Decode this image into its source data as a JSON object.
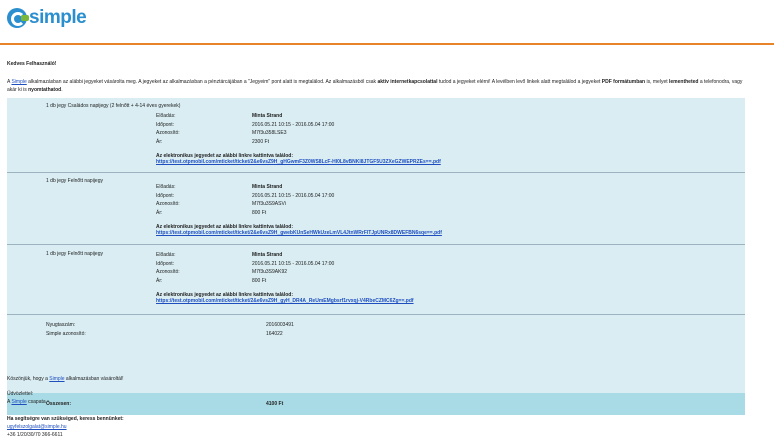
{
  "header": {
    "logo_text": "simple",
    "accent": "#e8832a",
    "brand": "#2a8ecf"
  },
  "greeting": "Kedves Felhasználó!",
  "intro": {
    "p1": "A ",
    "simple_link": "Simple",
    "p2": " alkalmazásban az alábbi jegyeket vásárolta meg. A jegyeket az alkalmazásban a pénztárcájában a \"Jegyeim\" pont alatt is megtalálod. Az alkalmazásból csak ",
    "b1": "aktív internetkapcsolattal",
    "p3": " tudod a jegyeket elérni! A levélben levő linkek alatt megtalálod a jegyeket ",
    "b2": "PDF formátumban",
    "p4": " is, melyet ",
    "b3": "lementheted",
    "p5": " a telefonodra, vagy akár ki is ",
    "b4": "nyomtathatod",
    "p6": "."
  },
  "tickets": [
    {
      "title": "1 db jegy Családos napijegy (2 felnőtt + 4-14 éves gyerekek)",
      "labels": [
        "Előadás:",
        "Időpont:",
        "Azonosító:",
        "Ár:"
      ],
      "values": [
        "Minta Strand",
        "2016.05.21 10:15 - 2016.05.04 17:00",
        "M7f3u358LSE3",
        "2300 Ft"
      ],
      "dl_title": "Az elektronikus jegyedet az alábbi linkre kattintva találod:",
      "dl_link": "https://test.otpmobil.com/mticket/ticket/2&e6vsZ9H_gHGwmF3Z0WS8LcF-Hl0L8vBNKl8JTGF5U3ZXeGZWEPRZEs==.pdf"
    },
    {
      "title": "1 db jegy Felnőtt napijegy",
      "labels": [
        "Előadás:",
        "Időpont:",
        "Azonosító:",
        "Ár:"
      ],
      "values": [
        "Minta Strand",
        "2016.05.21 10:15 - 2016.05.04 17:00",
        "M7f3u3S9ASVi",
        "800 Ft"
      ],
      "dl_title": "Az elektronikus jegyedet az alábbi linkre kattintva találod:",
      "dl_link": "https://test.otpmobil.com/mticket/ticket/2&e6vsZ9H_gwebKUnSeHWkUzeLmVL4JtnWRrFlTJpUNRx8DWEFBN6sqe==.pdf"
    },
    {
      "title": "1 db jegy Felnőtt napijegy",
      "labels": [
        "Előadás:",
        "Időpont:",
        "Azonosító:",
        "Ár:"
      ],
      "values": [
        "Minta Strand",
        "2016.05.21 10:15 - 2016.05.04 17:00",
        "M7f3u3S9AK92",
        "800 Ft"
      ],
      "dl_title": "Az elektronikus jegyedet az alábbi linkre kattintva találod:",
      "dl_link": "https://test.otpmobil.com/mticket/ticket/2&e6vsZ9H_gyH_DR4A_ReUmEMgbsrf1rvxqj-V4RbeCZMC6Zg==.pdf"
    }
  ],
  "meta": {
    "receipt_label": "Nyugtaszám:",
    "receipt_value": "2016003491",
    "simple_id_label": "Simple azonosító:",
    "simple_id_value": "164022"
  },
  "total": {
    "label": "Összesen:",
    "value": "4100 Ft"
  },
  "footer": {
    "thanks_a": "Köszönjük, hogy a ",
    "thanks_link": "Simple",
    "thanks_b": " alkalmazásban vásároltál!",
    "regards": "Üdvözlettel:",
    "team_a": "A ",
    "team_link": "Simple",
    "team_b": " csapata",
    "help": "Ha segítségre van szükséged, keress bennünket:",
    "email": "ugyfelszolgalat@simple.hu",
    "phone": "+36 1/20/30/70 366-6611"
  }
}
